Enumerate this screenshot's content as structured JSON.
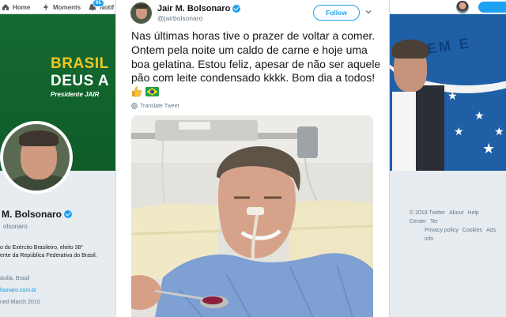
{
  "topnav": {
    "home": "Home",
    "moments": "Moments",
    "notifications": "Notif",
    "notif_count": "65"
  },
  "banner": {
    "line1": "BRASIL",
    "line2": "DEUS A",
    "line3": "Presidente JAIR",
    "flag_word": "EM E"
  },
  "profile": {
    "name": "M. Bolsonaro",
    "handle": "olsonaro",
    "bio_line1": "o do Exército Brasileiro, eleito 38°",
    "bio_line2": "ente da República Federativa do Brasil.",
    "location": "ásilia, Brasil",
    "url": "lsonaro.com.br",
    "joined": "ned March 2010"
  },
  "footer": {
    "line1": [
      "© 2019 Twitter",
      "About",
      "Help Center",
      "Ter"
    ],
    "line2": [
      "Privacy policy",
      "Cookies",
      "Ads info"
    ]
  },
  "tweet": {
    "author_name": "Jair M. Bolsonaro",
    "author_handle": "@jairbolsonaro",
    "follow_label": "Follow",
    "text": "Nas últimas horas tive o prazer de voltar a comer. Ontem pela noite um caldo de carne e hoje uma boa gelatina. Estou feliz, apesar de não ser aquele pão com leite condensado kkkk. Bom dia a todos! ",
    "translate_label": "Translate Tweet"
  },
  "colors": {
    "twitter_blue": "#1da1f2",
    "text_primary": "#14171a",
    "text_secondary": "#657786",
    "banner_green": "#1a6b34",
    "banner_yellow": "#f3c623"
  },
  "icons": {
    "home": "home-icon",
    "moments": "lightning-icon",
    "notifications": "bell-icon",
    "verified": "verified-badge-icon",
    "caret": "chevron-down-icon",
    "translate": "globe-icon",
    "thumbs_up": "thumbs-up-emoji",
    "flag": "brazil-flag-emoji"
  }
}
